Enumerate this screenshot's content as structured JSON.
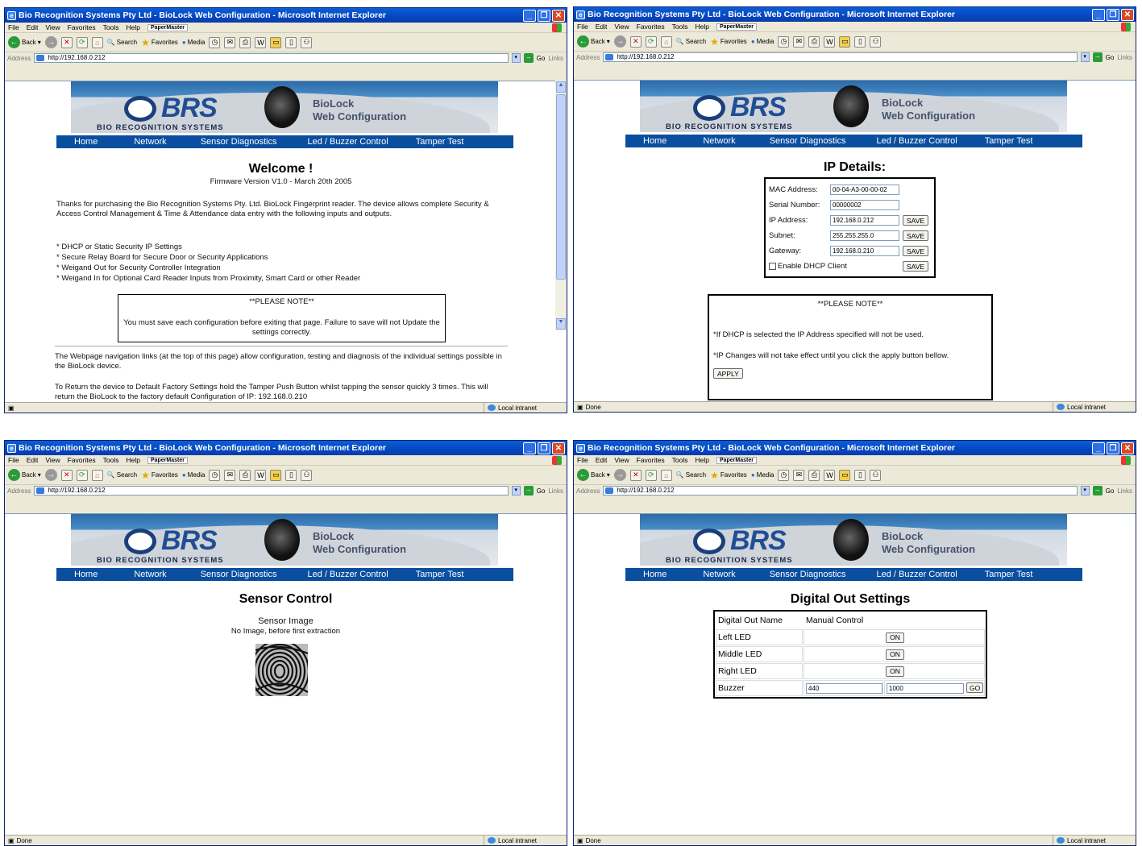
{
  "windows": [
    {
      "title": "Bio Recognition Systems Pty Ltd - BioLock Web Configuration - Microsoft Internet Explorer",
      "status": "",
      "zone": "Local intranet"
    },
    {
      "title": "Bio Recognition Systems Pty Ltd - BioLock Web Configuration - Microsoft Internet Explorer",
      "status": "Done",
      "zone": "Local intranet"
    },
    {
      "title": "Bio Recognition Systems Pty Ltd - BioLock Web Configuration - Microsoft Internet Explorer",
      "status": "Done",
      "zone": "Local intranet"
    },
    {
      "title": "Bio Recognition Systems Pty Ltd - BioLock Web Configuration - Microsoft Internet Explorer",
      "status": "Done",
      "zone": "Local intranet"
    }
  ],
  "browser": {
    "menu": [
      "File",
      "Edit",
      "View",
      "Favorites",
      "Tools",
      "Help"
    ],
    "papermaster": "PaperMaster",
    "back": "Back",
    "search": "Search",
    "favorites": "Favorites",
    "media": "Media",
    "address_label": "Address",
    "address": "http://192.168.0.212",
    "go": "Go",
    "links": "Links"
  },
  "banner": {
    "brs": "BRS",
    "line1": "BioLock",
    "line2": "Web Configuration",
    "company": "BIO RECOGNITION SYSTEMS"
  },
  "nav": {
    "home": "Home",
    "network": "Network",
    "sensor": "Sensor Diagnostics",
    "led": "Led / Buzzer Control",
    "tamper": "Tamper Test"
  },
  "welcome": {
    "heading": "Welcome !",
    "firmware": "Firmware Version V1.0 - March 20th 2005",
    "intro": "Thanks for purchasing the Bio Recognition Systems Pty. Ltd. BioLock Fingerprint reader. The device allows complete Security & Access Control Management & Time & Attendance data entry with the following inputs and outputs.",
    "bullets": [
      "* DHCP or Static Security IP Settings",
      "* Secure Relay Board for Secure Door or Security Applications",
      "* Weigand Out for Security Controller Integration",
      "* Weigand In for Optional Card Reader Inputs from Proximity, Smart Card or other Reader"
    ],
    "note_title": "**PLEASE NOTE**",
    "note_text": "You must save each configuration before exiting that page. Failure to save will not Update the settings correctly.",
    "para1": "The Webpage navigation links (at the top of this page) allow configuration, testing and diagnosis of the individual settings possible in the BioLock device.",
    "para2": "To Return the device to Default Factory Settings hold the Tamper Push Button whilst tapping the sensor quickly 3 times. This will return the BioLock to the factory default Configuration of IP: 192.168.0.210"
  },
  "ip": {
    "heading": "IP Details:",
    "mac_label": "MAC Address:",
    "mac": "00-04-A3-00-00-02",
    "serial_label": "Serial Number:",
    "serial": "00000002",
    "ip_label": "IP Address:",
    "ip": "192.168.0.212",
    "subnet_label": "Subnet:",
    "subnet": "255.255.255.0",
    "gateway_label": "Gateway:",
    "gateway": "192.168.0.210",
    "dhcp_label": "Enable DHCP Client",
    "save": "SAVE",
    "note_title": "**PLEASE NOTE**",
    "note1": "*If DHCP is selected the IP Address specified will not be used.",
    "note2": "*IP Changes will not take effect until you click the apply button bellow.",
    "apply": "APPLY"
  },
  "sensor": {
    "heading": "Sensor Control",
    "label": "Sensor Image",
    "sub": "No Image, before first extraction"
  },
  "digital": {
    "heading": "Digital Out Settings",
    "col1": "Digital Out Name",
    "col2": "Manual Control",
    "rows": [
      {
        "name": "Left LED",
        "btn": "ON"
      },
      {
        "name": "Middle LED",
        "btn": "ON"
      },
      {
        "name": "Right LED",
        "btn": "ON"
      }
    ],
    "buzzer": "Buzzer",
    "freq": "440",
    "dur": "1000",
    "go": "GO"
  }
}
